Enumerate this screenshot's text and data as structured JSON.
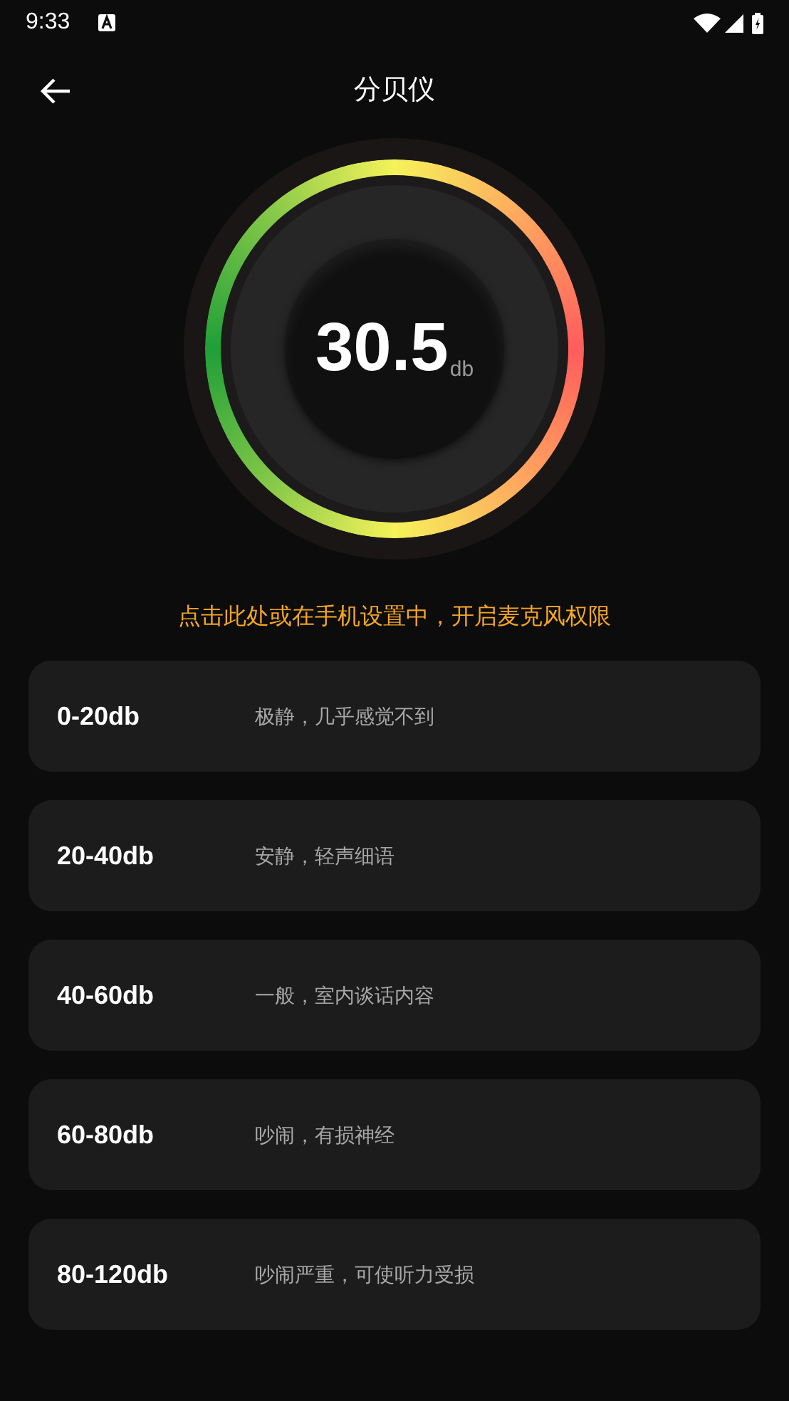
{
  "status_bar": {
    "time": "9:33"
  },
  "header": {
    "title": "分贝仪"
  },
  "meter": {
    "value": "30.5",
    "unit": "db"
  },
  "permission_notice": "点击此处或在手机设置中，开启麦克风权限",
  "levels": [
    {
      "range": "0-20db",
      "description": "极静，几乎感觉不到"
    },
    {
      "range": "20-40db",
      "description": "安静，轻声细语"
    },
    {
      "range": "40-60db",
      "description": "一般，室内谈话内容"
    },
    {
      "range": "60-80db",
      "description": "吵闹，有损神经"
    },
    {
      "range": "80-120db",
      "description": "吵闹严重，可使听力受损"
    }
  ]
}
